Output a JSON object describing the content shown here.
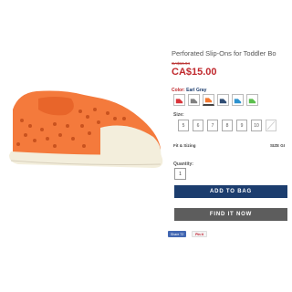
{
  "product": {
    "title": "Perforated Slip-Ons for Toddler Bo",
    "old_price": "CA$16.94",
    "price": "CA$15.00"
  },
  "color": {
    "label": "Color:",
    "selected_value": "Earl Gray",
    "swatches": [
      {
        "name": "red",
        "color": "#d9343a"
      },
      {
        "name": "gray",
        "color": "#808080"
      },
      {
        "name": "orange",
        "color": "#f4772e"
      },
      {
        "name": "navy",
        "color": "#2f4d74"
      },
      {
        "name": "blue",
        "color": "#2c92cf"
      },
      {
        "name": "green",
        "color": "#5bbf4d"
      }
    ]
  },
  "size": {
    "label": "Size:",
    "options": [
      "5",
      "6",
      "7",
      "8",
      "9",
      "10",
      ""
    ]
  },
  "fit": {
    "label": "Fit & Sizing",
    "guide": "SIZE GI"
  },
  "quantity": {
    "label": "Quantity:",
    "value": "1"
  },
  "buttons": {
    "add_to_bag": "ADD TO BAG",
    "find_it_now": "FIND IT NOW"
  },
  "social": {
    "facebook": "Share 72",
    "pinterest": "Pin it"
  },
  "colors": {
    "brand_navy": "#1c3d6e",
    "price_red": "#c0282d",
    "find_gray": "#5d5d5d",
    "shoe_orange": "#f47a3c"
  }
}
